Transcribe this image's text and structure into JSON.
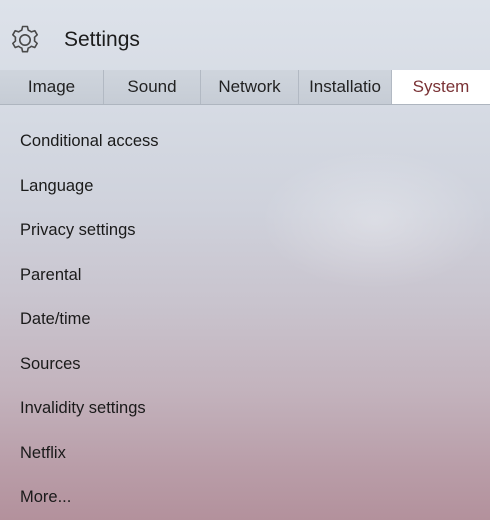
{
  "header": {
    "title": "Settings",
    "icon": "gear-icon"
  },
  "tabs": [
    {
      "label": "Image",
      "active": false
    },
    {
      "label": "Sound",
      "active": false
    },
    {
      "label": "Network",
      "active": false
    },
    {
      "label": "Installatio",
      "active": false
    },
    {
      "label": "System",
      "active": true
    }
  ],
  "menu": {
    "items": [
      {
        "label": "Conditional access"
      },
      {
        "label": "Language"
      },
      {
        "label": "Privacy settings"
      },
      {
        "label": "Parental"
      },
      {
        "label": "Date/time"
      },
      {
        "label": "Sources"
      },
      {
        "label": "Invalidity settings"
      },
      {
        "label": "Netflix"
      },
      {
        "label": "More..."
      }
    ]
  },
  "colors": {
    "active_tab_text": "#7a3235",
    "active_tab_background": "#ffffff"
  }
}
